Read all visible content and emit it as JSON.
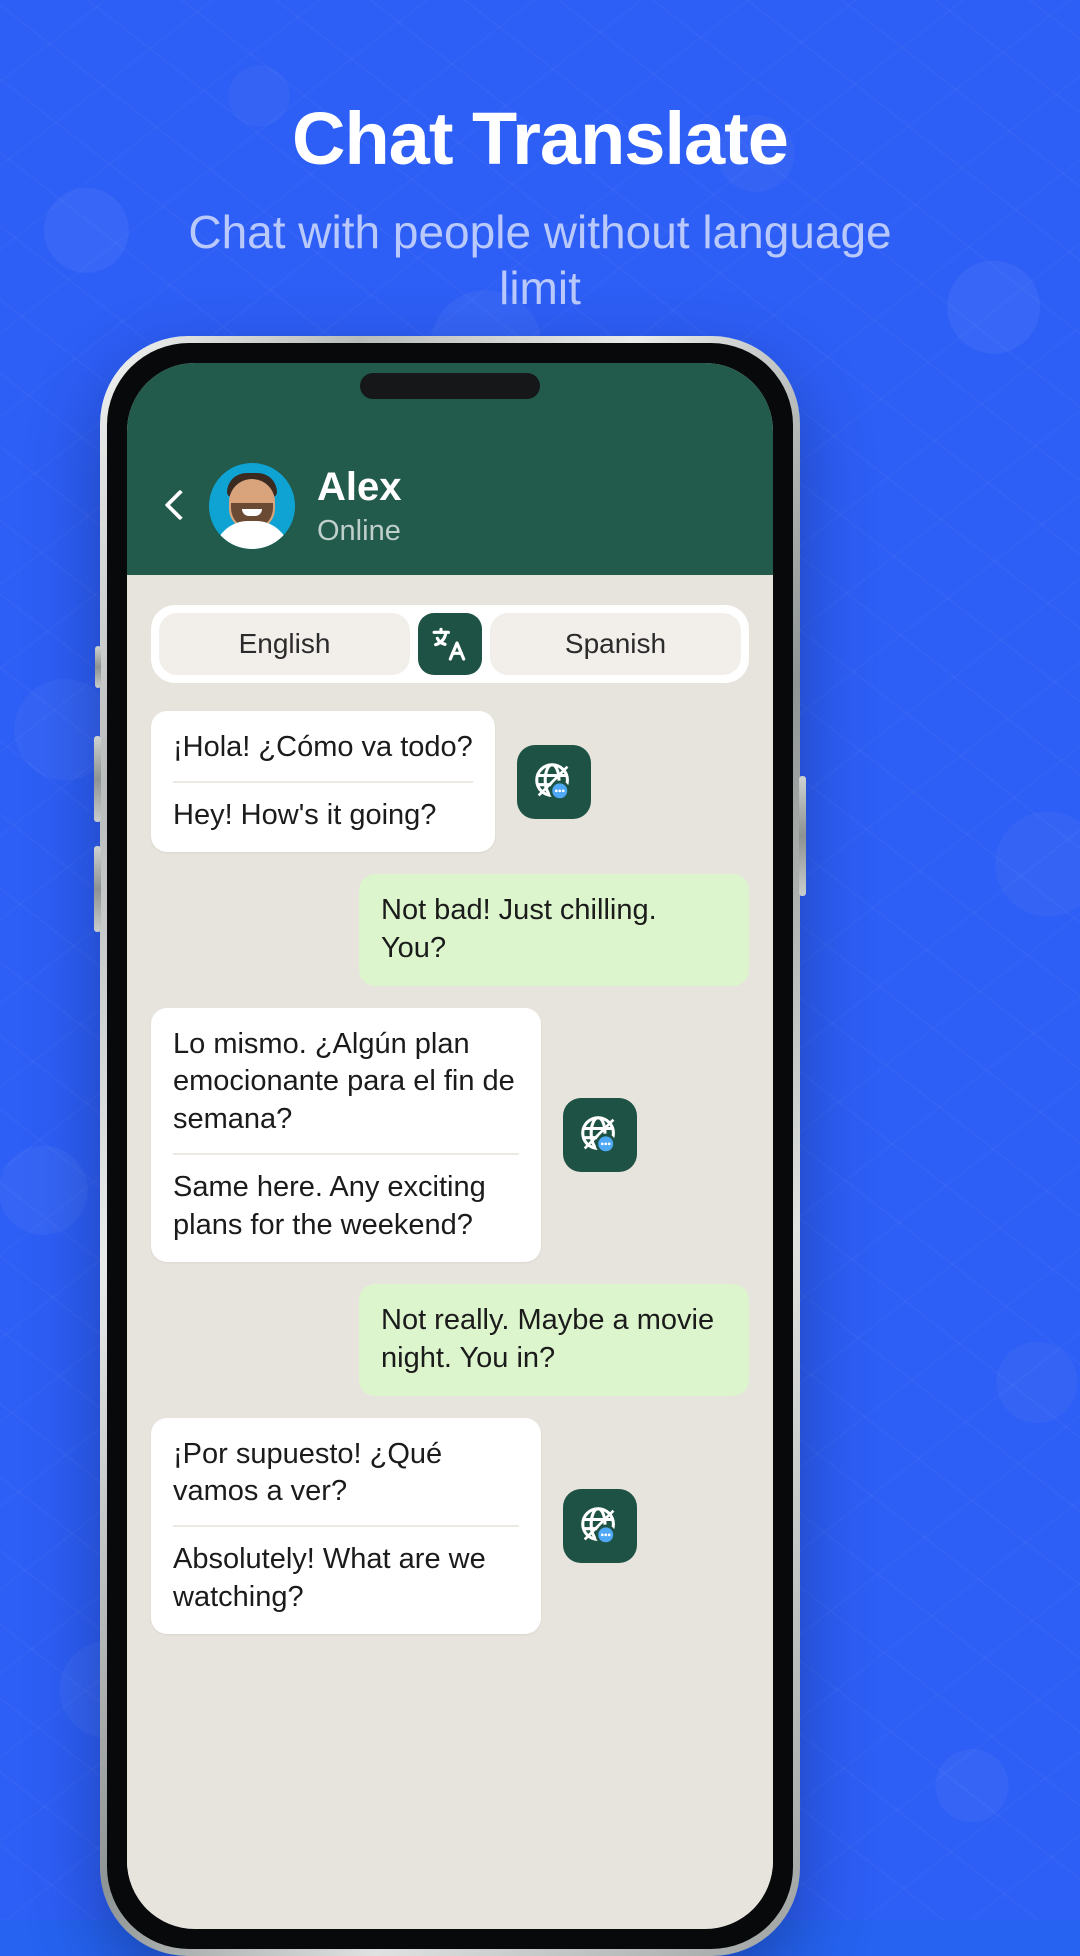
{
  "hero": {
    "title": "Chat Translate",
    "subtitle": "Chat with people without language limit"
  },
  "colors": {
    "background_blue": "#2d5ef5",
    "header_green": "#225a4c",
    "badge_green": "#1e5244",
    "outgoing_bubble": "#dcf5cd",
    "incoming_bubble": "#ffffff",
    "chat_background": "#e7e3dd",
    "avatar_background": "#0fa3d4",
    "subtitle_text": "#b9c9fb"
  },
  "phone": {
    "header": {
      "back_label": "Back",
      "contact_name": "Alex",
      "contact_status": "Online",
      "avatar_alt": "Alex profile photo"
    },
    "language_bar": {
      "source_language": "English",
      "target_language": "Spanish",
      "translate_icon": "translate-icon"
    },
    "messages": [
      {
        "side": "incoming",
        "original": "¡Hola! ¿Cómo va todo?",
        "translation": "Hey! How's it going?",
        "has_translate_badge": true
      },
      {
        "side": "outgoing",
        "text": "Not bad! Just chilling. You?",
        "has_translate_badge": false
      },
      {
        "side": "incoming",
        "original": "Lo mismo. ¿Algún plan emocionante para el fin de semana?",
        "translation": "Same here. Any exciting plans for the weekend?",
        "has_translate_badge": true
      },
      {
        "side": "outgoing",
        "text": "Not really. Maybe a movie night. You in?",
        "has_translate_badge": false
      },
      {
        "side": "incoming",
        "original": "¡Por supuesto! ¿Qué vamos a ver?",
        "translation": "Absolutely! What are we watching?",
        "has_translate_badge": true
      }
    ]
  }
}
